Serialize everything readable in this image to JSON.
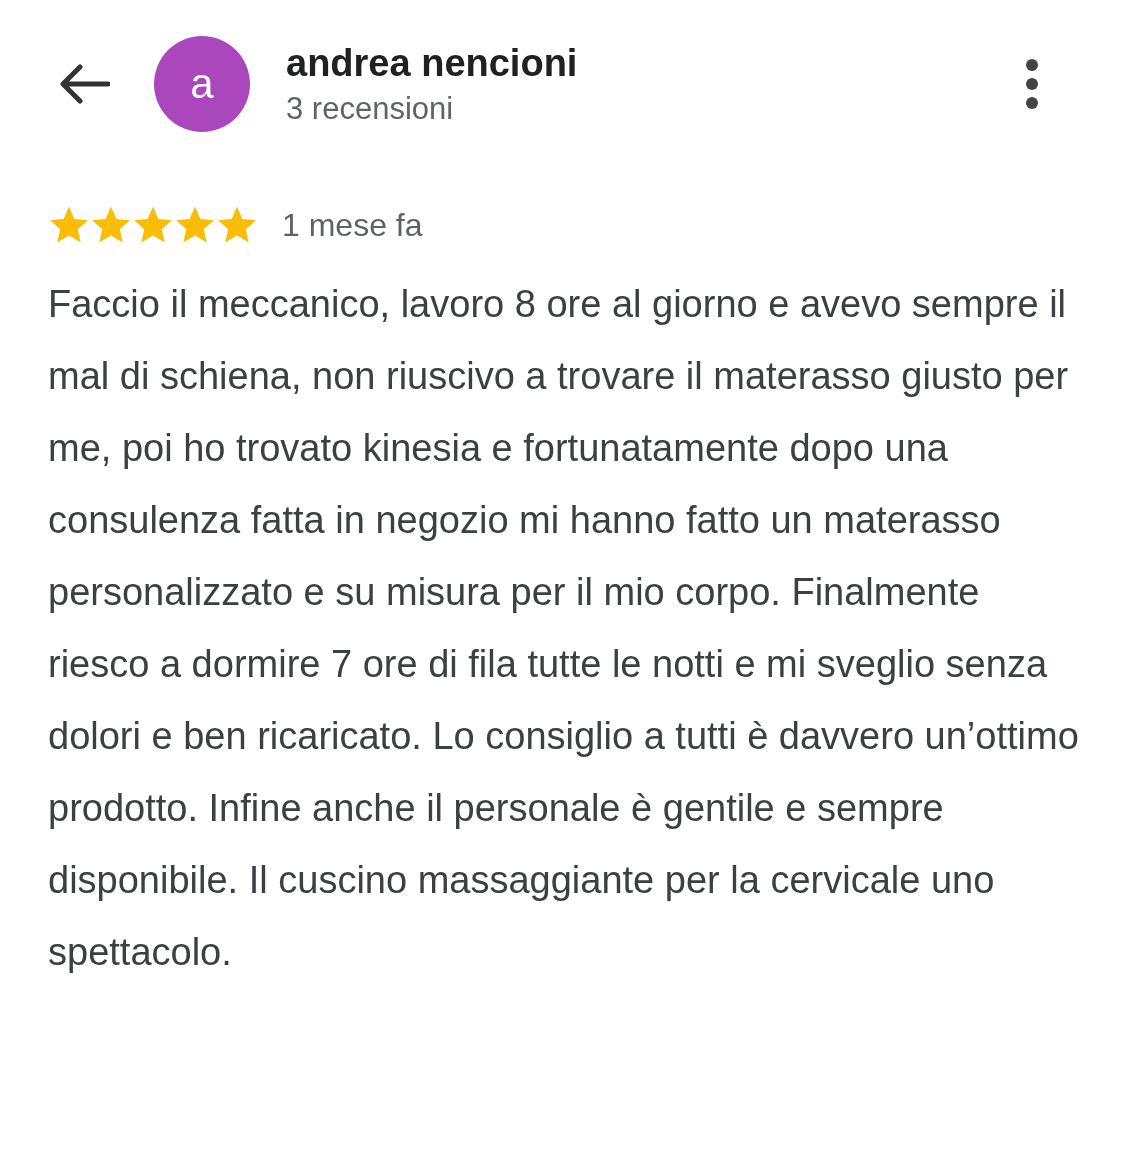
{
  "reviewer": {
    "avatar_letter": "a",
    "name": "andrea nencioni",
    "reviews_count": "3 recensioni"
  },
  "review": {
    "stars": 5,
    "time": "1 mese fa",
    "text": "Faccio il meccanico, lavoro 8 ore al giorno e avevo sempre il mal di schiena, non riuscivo a trovare il materasso giusto per me, poi ho trovato kinesia e fortunatamente dopo una consulenza fatta in negozio mi hanno fatto un materasso personalizzato e su misura per il mio corpo. Finalmente riesco a dormire 7 ore di fila tutte le notti e mi sveglio senza dolori e ben ricaricato. Lo consiglio a tutti è davvero un’ottimo prodotto. Infine anche il personale è gentile e sempre disponibile. Il cuscino massaggiante per la cervicale uno spettacolo."
  }
}
